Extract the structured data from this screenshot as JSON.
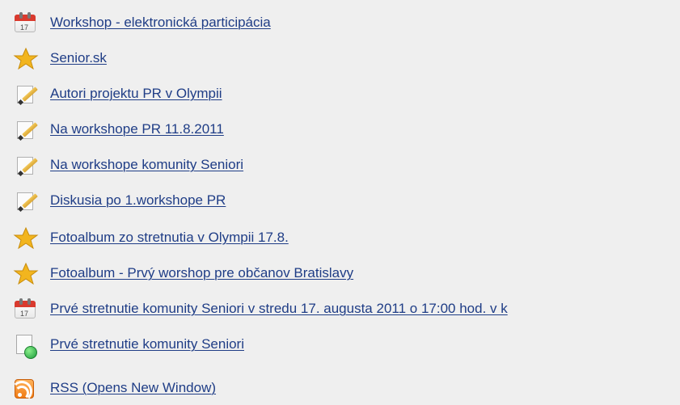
{
  "items": [
    {
      "icon": "calendar-icon",
      "label": "Workshop - elektronická participácia",
      "calendar_number": "17"
    },
    {
      "icon": "star-icon",
      "label": "Senior.sk"
    },
    {
      "icon": "edit-document-icon",
      "label": "Autori projektu PR v Olympii"
    },
    {
      "icon": "edit-document-icon",
      "label": "Na workshope PR 11.8.2011"
    },
    {
      "icon": "edit-document-icon",
      "label": "Na workshope komunity Seniori"
    },
    {
      "icon": "edit-document-icon",
      "label": "Diskusia po 1.workshope PR"
    },
    {
      "icon": "star-icon",
      "label": "Fotoalbum zo stretnutia v Olympii 17.8."
    },
    {
      "icon": "star-icon",
      "label": "Fotoalbum - Prvý worshop pre občanov Bratislavy"
    },
    {
      "icon": "calendar-icon",
      "label": "Prvé stretnutie komunity Seniori v stredu 17. augusta 2011 o 17:00 hod. v k",
      "calendar_number": "17"
    },
    {
      "icon": "web-page-icon",
      "label": "Prvé stretnutie komunity Seniori"
    },
    {
      "icon": "rss-icon",
      "label": "RSS (Opens New Window)"
    }
  ],
  "colors": {
    "background": "#efefef",
    "link": "#1f3d86"
  }
}
